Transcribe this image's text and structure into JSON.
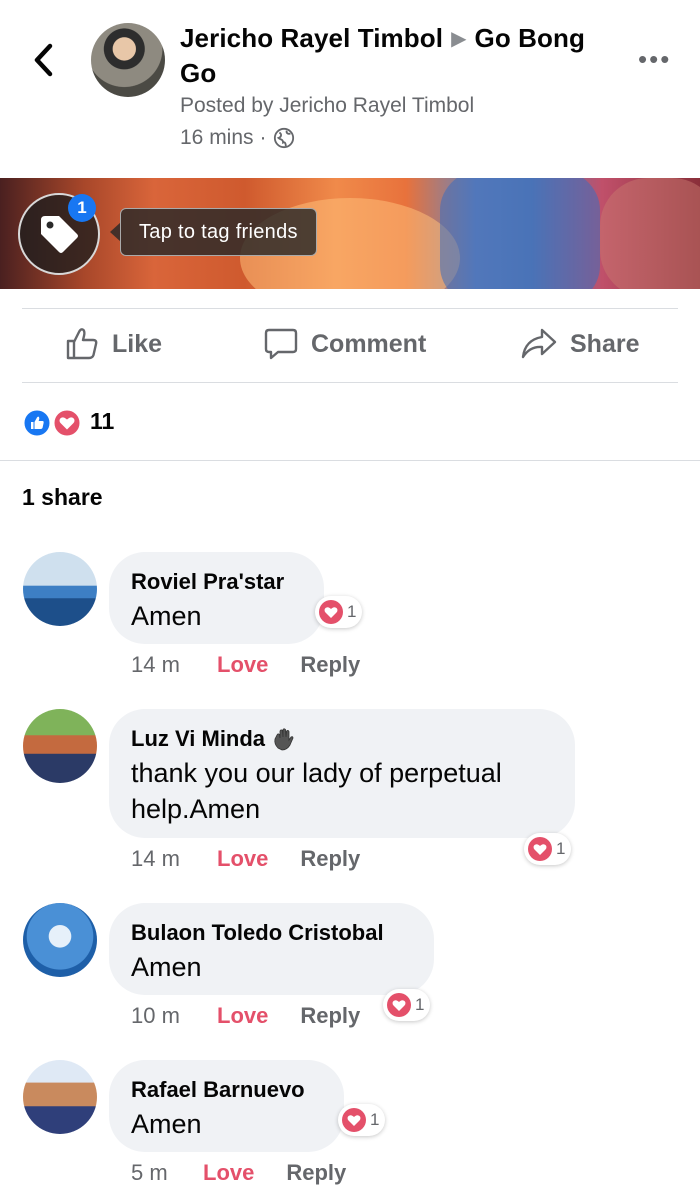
{
  "post": {
    "author": "Jericho Rayel Timbol",
    "arrow": "▶",
    "group": "Go Bong Go",
    "posted_by": "Posted by Jericho Rayel Timbol",
    "time": "16 mins",
    "dot": "·",
    "more": "•••"
  },
  "tag": {
    "badge": "1",
    "tooltip": "Tap to tag friends"
  },
  "actions": {
    "like": "Like",
    "comment": "Comment",
    "share": "Share"
  },
  "reactions": {
    "count": "11"
  },
  "shares": "1 share",
  "comments": [
    {
      "name": "Roviel Pra'star",
      "text": "Amen",
      "time": "14 m",
      "love": "Love",
      "reply": "Reply",
      "reaction_count": "1"
    },
    {
      "name": "Luz Vi Minda",
      "text": "thank you our lady of perpetual help.Amen",
      "time": "14 m",
      "love": "Love",
      "reply": "Reply",
      "reaction_count": "1"
    },
    {
      "name": "Bulaon Toledo Cristobal",
      "text": "Amen",
      "time": "10 m",
      "love": "Love",
      "reply": "Reply",
      "reaction_count": "1"
    },
    {
      "name": "Rafael Barnuevo",
      "text": "Amen",
      "time": "5 m",
      "love": "Love",
      "reply": "Reply",
      "reaction_count": "1"
    }
  ],
  "colors": {
    "accent": "#1877f2",
    "love": "#e4506a",
    "bubble": "#f0f2f5",
    "secondary_text": "#65676b"
  }
}
